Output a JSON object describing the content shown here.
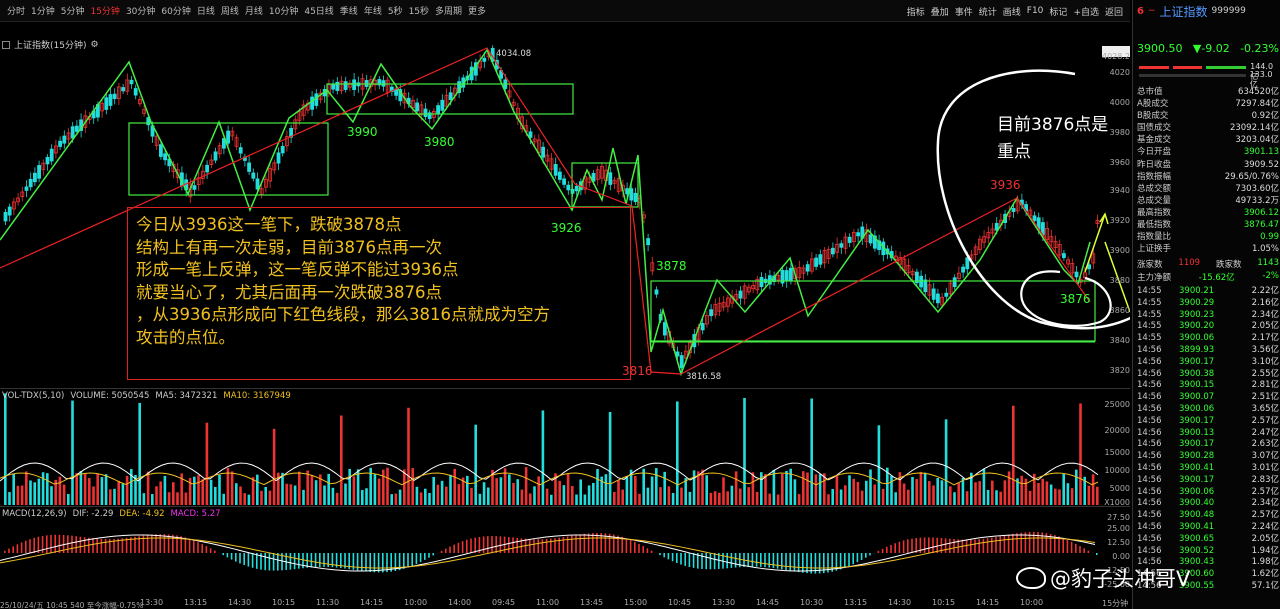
{
  "toolbar": {
    "left": [
      "分时",
      "1分钟",
      "5分钟",
      "15分钟",
      "30分钟",
      "60分钟",
      "日线",
      "周线",
      "月线",
      "10分钟",
      "45日线",
      "季线",
      "年线",
      "5秒",
      "15秒",
      "多周期",
      "更多"
    ],
    "active": "15分钟",
    "right": [
      "指标",
      "叠加",
      "事件",
      "统计",
      "画线",
      "F10",
      "标记",
      "+自选",
      "返回"
    ]
  },
  "chart": {
    "title": "上证指数(15分钟)",
    "high_label": "4034.08",
    "low_label": "3816.58",
    "y_ticks": [
      "4028.2",
      "4020",
      "4000",
      "3980",
      "3960",
      "3940",
      "3920",
      "3900",
      "3880",
      "3860",
      "3840",
      "3820"
    ],
    "level_labels": [
      {
        "text": "3990",
        "color": "g"
      },
      {
        "text": "3980",
        "color": "g"
      },
      {
        "text": "3926",
        "color": "g"
      },
      {
        "text": "3878",
        "color": "g"
      },
      {
        "text": "3816",
        "color": "r"
      },
      {
        "text": "3936",
        "color": "r"
      },
      {
        "text": "3876",
        "color": "g"
      }
    ],
    "annotation_lines": [
      "今日从3936这一笔下，跌破3878点",
      "结构上有再一次走弱，目前3876点再一次",
      "形成一笔上反弹，这一笔反弹不能过3936点",
      "就要当心了，尤其后面再一次跌破3876点",
      "，从3936点形成向下红色线段，那么3816点就成为空方",
      "攻击的点位。"
    ],
    "handwritten": [
      "目前3876点是",
      "重点"
    ]
  },
  "volume": {
    "header": [
      "VOL-TDX(5,10)",
      "VOLUME: 5050545",
      "MA5: 3472321",
      "MA10: 3167949"
    ],
    "header_colors": [
      "#ccc",
      "#ccc",
      "#ccc",
      "#f0c020"
    ],
    "y_ticks": [
      "25000",
      "20000",
      "15000",
      "10000",
      "5000",
      "X1000"
    ]
  },
  "macd": {
    "header": [
      "MACD(12,26,9)",
      "DIF: -2.29",
      "DEA: -4.92",
      "MACD: 5.27"
    ],
    "header_colors": [
      "#ccc",
      "#ccc",
      "#f0c020",
      "#e3e"
    ],
    "y_ticks": [
      "27.50",
      "25.00",
      "12.50",
      "0.00",
      "-12.50",
      "-25.00"
    ]
  },
  "time_axis": [
    "13:30",
    "13:15",
    "14:30",
    "10:15",
    "11:30",
    "14:15",
    "10:00",
    "14:00",
    "09:45",
    "11:00",
    "13:45",
    "15:00",
    "10:45",
    "13:30",
    "14:45",
    "10:30",
    "13:15",
    "14:30",
    "10:15",
    "14:15",
    "10:00",
    "15分钟"
  ],
  "status_bar": "25/10/24/五 10:45 540 至今涨幅-0.75%",
  "rpanel": {
    "badge": "6",
    "name": "上证指数",
    "code": "999999",
    "price": "3900.50",
    "change": "▼-9.02",
    "pct": "-0.23%",
    "bar_values": [
      "144.0亿",
      "133.0亿"
    ],
    "rows": [
      {
        "k": "总市值",
        "v": "634520亿",
        "c": ""
      },
      {
        "k": "A股成交",
        "v": "7297.84亿",
        "c": ""
      },
      {
        "k": "B股成交",
        "v": "0.92亿",
        "c": ""
      },
      {
        "k": "国债成交",
        "v": "23092.14亿",
        "c": ""
      },
      {
        "k": "基金成交",
        "v": "3203.04亿",
        "c": ""
      },
      {
        "k": "今日开盘",
        "v": "3901.13",
        "c": "g"
      },
      {
        "k": "昨日收盘",
        "v": "3909.52",
        "c": ""
      },
      {
        "k": "指数振幅",
        "v": "29.65/0.76%",
        "c": ""
      },
      {
        "k": "总成交额",
        "v": "7303.60亿",
        "c": ""
      },
      {
        "k": "总成交量",
        "v": "49733.2万",
        "c": ""
      },
      {
        "k": "最高指数",
        "v": "3906.12",
        "c": "g"
      },
      {
        "k": "最低指数",
        "v": "3876.47",
        "c": "g"
      },
      {
        "k": "指数量比",
        "v": "0.99",
        "c": "g"
      },
      {
        "k": "上证换手",
        "v": "1.05%",
        "c": ""
      }
    ],
    "up_label": "涨家数",
    "up_count": "1109",
    "down_label": "跌家数",
    "down_count": "1143",
    "flow_label": "主力净额",
    "flow_value": "-15.62亿",
    "flow_pct": "-2%",
    "ticks": [
      {
        "t": "14:55",
        "p": "3900.21",
        "v": "2.22亿"
      },
      {
        "t": "14:55",
        "p": "3900.29",
        "v": "2.16亿"
      },
      {
        "t": "14:55",
        "p": "3900.23",
        "v": "2.34亿"
      },
      {
        "t": "14:55",
        "p": "3900.20",
        "v": "2.05亿"
      },
      {
        "t": "14:55",
        "p": "3900.06",
        "v": "2.17亿"
      },
      {
        "t": "14:56",
        "p": "3899.93",
        "v": "3.56亿"
      },
      {
        "t": "14:56",
        "p": "3900.17",
        "v": "3.10亿"
      },
      {
        "t": "14:56",
        "p": "3900.38",
        "v": "2.55亿"
      },
      {
        "t": "14:56",
        "p": "3900.15",
        "v": "2.81亿"
      },
      {
        "t": "14:56",
        "p": "3900.07",
        "v": "2.51亿"
      },
      {
        "t": "14:56",
        "p": "3900.06",
        "v": "3.65亿"
      },
      {
        "t": "14:56",
        "p": "3900.17",
        "v": "2.57亿"
      },
      {
        "t": "14:56",
        "p": "3900.13",
        "v": "2.47亿"
      },
      {
        "t": "14:56",
        "p": "3900.17",
        "v": "2.63亿"
      },
      {
        "t": "14:56",
        "p": "3900.28",
        "v": "3.07亿"
      },
      {
        "t": "14:56",
        "p": "3900.41",
        "v": "3.01亿"
      },
      {
        "t": "14:56",
        "p": "3900.17",
        "v": "2.83亿"
      },
      {
        "t": "14:56",
        "p": "3900.06",
        "v": "2.57亿"
      },
      {
        "t": "14:56",
        "p": "3900.40",
        "v": "2.34亿"
      },
      {
        "t": "14:56",
        "p": "3900.48",
        "v": "2.57亿"
      },
      {
        "t": "14:56",
        "p": "3900.41",
        "v": "2.24亿"
      },
      {
        "t": "14:56",
        "p": "3900.65",
        "v": "2.05亿"
      },
      {
        "t": "14:56",
        "p": "3900.52",
        "v": "1.94亿"
      },
      {
        "t": "14:56",
        "p": "3900.43",
        "v": "1.98亿"
      },
      {
        "t": "14:56",
        "p": "3900.60",
        "v": "1.62亿"
      },
      {
        "t": "14:56",
        "p": "3900.55",
        "v": "57.1亿"
      }
    ]
  },
  "watermark": "@豹子头冲哥V",
  "colors": {
    "up": "#e33",
    "down": "#3f3",
    "accent": "#f0c020",
    "pen": "#44ee44"
  }
}
